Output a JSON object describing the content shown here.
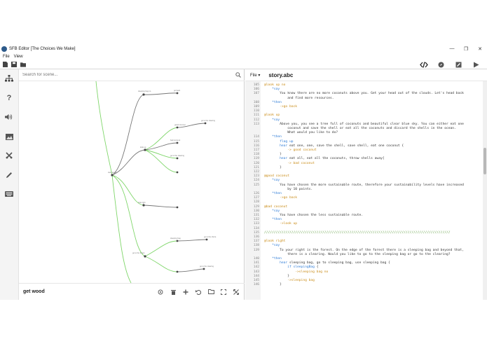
{
  "window": {
    "title": "SFB Editor [The Choices We Make]",
    "minimize": "—",
    "maximize": "❐",
    "close": "✕"
  },
  "menu": {
    "items": [
      "File",
      "View"
    ]
  },
  "toolbar": {
    "icons": [
      "new-file-icon",
      "save-icon",
      "open-folder-icon"
    ]
  },
  "modes": {
    "icons": [
      "code-icon",
      "compass-icon",
      "edit-icon",
      "play-icon"
    ]
  },
  "rail": {
    "icons": [
      "scene-tree-icon",
      "help-icon",
      "sound-icon",
      "image-icon",
      "tools-icon",
      "pen-icon",
      "keyboard-icon"
    ]
  },
  "scene": {
    "search_placeholder": "Search for scene...",
    "current_scene": "get wood",
    "tool_icons": [
      "target-icon",
      "trash-icon",
      "add-icon",
      "undo-icon",
      "folder-icon",
      "fit-icon",
      "expand-icon"
    ],
    "nodes": [
      {
        "id": "n-root",
        "label": "start wood"
      },
      {
        "id": "n-sleep",
        "label": "sleeping bag no"
      },
      {
        "id": "n-coco",
        "label": "look up"
      },
      {
        "id": "n-good",
        "label": "good coconut"
      },
      {
        "id": "n-bad",
        "label": "bad coconut"
      },
      {
        "id": "n-right",
        "label": "look right"
      },
      {
        "id": "n-forest",
        "label": "go to the forest"
      },
      {
        "id": "n-clear",
        "label": "go to the clearing"
      },
      {
        "id": "n-leaf1",
        "label": "go to the clearing"
      },
      {
        "id": "n-leaf2",
        "label": "go to the shore"
      },
      {
        "id": "n-leaf3",
        "label": "sleeping bag"
      },
      {
        "id": "n-leaf4",
        "label": "go to the clearing"
      },
      {
        "id": "n-leaf5",
        "label": "go back"
      }
    ]
  },
  "editor": {
    "file_menu": "File ▾",
    "filename": "story.abc",
    "lines": [
      {
        "n": "105",
        "parts": [
          [
            "lbl",
            "@look up no"
          ]
        ]
      },
      {
        "n": "106",
        "parts": [
          [
            "key",
            "    *say"
          ]
        ]
      },
      {
        "n": "107",
        "parts": [
          [
            "txt",
            "        You know there are no more coconuts above you. Get your head out of the clouds. Let's head back"
          ]
        ]
      },
      {
        "n": "",
        "parts": [
          [
            "txt",
            "            and find more resources."
          ]
        ]
      },
      {
        "n": "108",
        "parts": [
          [
            "key",
            "    *then"
          ]
        ]
      },
      {
        "n": "109",
        "parts": [
          [
            "go",
            "        ->go back"
          ]
        ]
      },
      {
        "n": "110",
        "parts": [
          [
            "txt",
            ""
          ]
        ]
      },
      {
        "n": "111",
        "parts": [
          [
            "lbl",
            "@look up"
          ]
        ]
      },
      {
        "n": "112",
        "parts": [
          [
            "key",
            "    *say"
          ]
        ]
      },
      {
        "n": "113",
        "parts": [
          [
            "txt",
            "        Above you, you see a tree full of coconuts and beautiful clear blue sky. You can either eat one"
          ]
        ]
      },
      {
        "n": "",
        "parts": [
          [
            "txt",
            "            coconut and save the shell or eat all the coconuts and discard the shells in the ocean."
          ]
        ]
      },
      {
        "n": "",
        "parts": [
          [
            "txt",
            "            What would you like to do?"
          ]
        ]
      },
      {
        "n": "114",
        "parts": [
          [
            "key",
            "    *then"
          ]
        ]
      },
      {
        "n": "115",
        "parts": [
          [
            "key",
            "        flag up"
          ]
        ]
      },
      {
        "n": "116",
        "parts": [
          [
            "key",
            "        hear "
          ],
          [
            "txt",
            "eat one, one, save the shell, save shell, eat one coconut {"
          ]
        ]
      },
      {
        "n": "117",
        "parts": [
          [
            "go",
            "            -> good coconut"
          ]
        ]
      },
      {
        "n": "118",
        "parts": [
          [
            "txt",
            "        }"
          ]
        ]
      },
      {
        "n": "119",
        "parts": [
          [
            "key",
            "        hear "
          ],
          [
            "txt",
            "eat all, eat all the coconuts, throw shells away{"
          ]
        ]
      },
      {
        "n": "120",
        "parts": [
          [
            "go",
            "            -> bad coconut"
          ]
        ]
      },
      {
        "n": "121",
        "parts": [
          [
            "txt",
            "        }"
          ]
        ]
      },
      {
        "n": "122",
        "parts": [
          [
            "txt",
            ""
          ]
        ]
      },
      {
        "n": "123",
        "parts": [
          [
            "lbl",
            "@good coconut"
          ]
        ]
      },
      {
        "n": "124",
        "parts": [
          [
            "key",
            "    *say"
          ]
        ]
      },
      {
        "n": "125",
        "parts": [
          [
            "txt",
            "        You have chosen the more sustainable route, therefore your sustainability levels have increased"
          ]
        ]
      },
      {
        "n": "",
        "parts": [
          [
            "txt",
            "            by 10 points."
          ]
        ]
      },
      {
        "n": "126",
        "parts": [
          [
            "key",
            "    *then"
          ]
        ]
      },
      {
        "n": "127",
        "parts": [
          [
            "go",
            "        ->go back"
          ]
        ]
      },
      {
        "n": "128",
        "parts": [
          [
            "txt",
            ""
          ]
        ]
      },
      {
        "n": "129",
        "parts": [
          [
            "lbl",
            "@bad coconut"
          ]
        ]
      },
      {
        "n": "130",
        "parts": [
          [
            "key",
            "    *say"
          ]
        ]
      },
      {
        "n": "131",
        "parts": [
          [
            "txt",
            "        You have chosen the less sustainable route."
          ]
        ]
      },
      {
        "n": "132",
        "parts": [
          [
            "key",
            "    *then"
          ]
        ]
      },
      {
        "n": "133",
        "parts": [
          [
            "go",
            "        ->look up"
          ]
        ]
      },
      {
        "n": "134",
        "parts": [
          [
            "txt",
            ""
          ]
        ]
      },
      {
        "n": "135",
        "parts": [
          [
            "com",
            "////////////////////////////////////////////////////////////////////////////////////////////////"
          ]
        ]
      },
      {
        "n": "136",
        "parts": [
          [
            "txt",
            ""
          ]
        ]
      },
      {
        "n": "137",
        "parts": [
          [
            "lbl",
            "@look right"
          ]
        ]
      },
      {
        "n": "138",
        "parts": [
          [
            "key",
            "    *say"
          ]
        ]
      },
      {
        "n": "139",
        "parts": [
          [
            "txt",
            "        To your right is the forest. On the edge of the forest there is a sleeping bag and beyond that,"
          ]
        ]
      },
      {
        "n": "",
        "parts": [
          [
            "txt",
            "            there is a clearing. Would you like to go to the sleeping bag or go to the clearing?"
          ]
        ]
      },
      {
        "n": "140",
        "parts": [
          [
            "key",
            "    *then"
          ]
        ]
      },
      {
        "n": "141",
        "parts": [
          [
            "key",
            "        hear "
          ],
          [
            "txt",
            "sleeping bag, go to sleeping bag, use sleeping bag {"
          ]
        ]
      },
      {
        "n": "142",
        "parts": [
          [
            "key",
            "            if sleepingBag "
          ],
          [
            "txt",
            "{"
          ]
        ]
      },
      {
        "n": "143",
        "parts": [
          [
            "go",
            "                ->sleeping bag no"
          ]
        ]
      },
      {
        "n": "144",
        "parts": [
          [
            "txt",
            "            }"
          ]
        ]
      },
      {
        "n": "145",
        "parts": [
          [
            "go",
            "            ->sleeping bag"
          ]
        ]
      },
      {
        "n": "146",
        "parts": [
          [
            "txt",
            "        }"
          ]
        ]
      }
    ]
  }
}
